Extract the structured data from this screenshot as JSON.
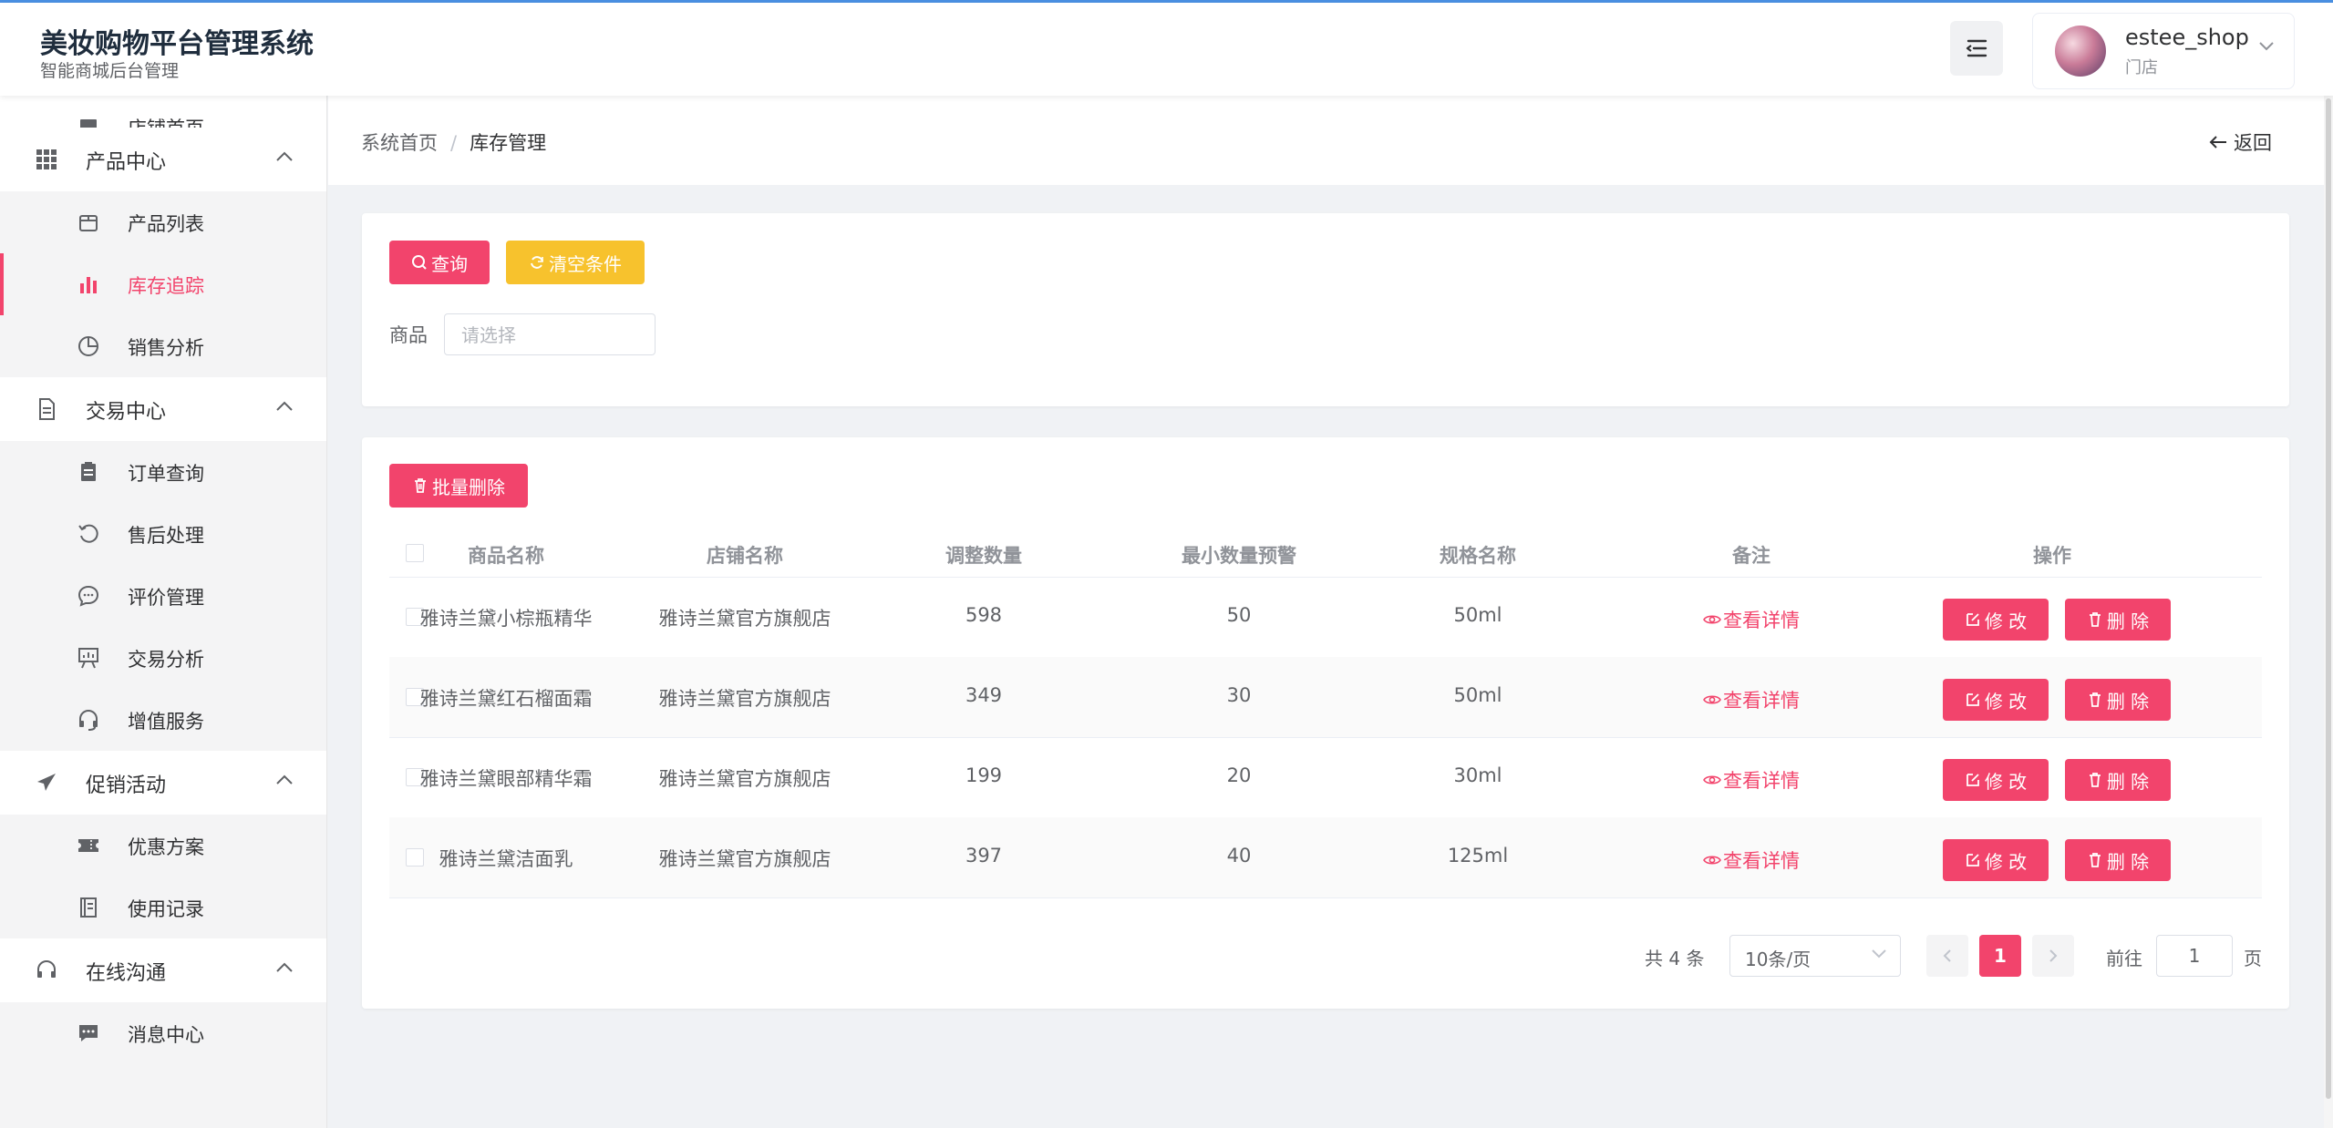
{
  "header": {
    "title": "美妆购物平台管理系统",
    "subtitle": "智能商城后台管理",
    "user": {
      "name": "estee_shop",
      "role": "门店"
    }
  },
  "sidebar": {
    "top_item": "店铺首页",
    "groups": [
      {
        "label": "产品中心",
        "items": [
          "产品列表",
          "库存追踪",
          "销售分析"
        ]
      },
      {
        "label": "交易中心",
        "items": [
          "订单查询",
          "售后处理",
          "评价管理",
          "交易分析",
          "增值服务"
        ]
      },
      {
        "label": "促销活动",
        "items": [
          "优惠方案",
          "使用记录"
        ]
      },
      {
        "label": "在线沟通",
        "items": [
          "消息中心"
        ]
      }
    ],
    "active_item": "库存追踪"
  },
  "breadcrumb": {
    "home": "系统首页",
    "separator": "/",
    "current": "库存管理",
    "back": "返回"
  },
  "search": {
    "query_button": "查询",
    "clear_button": "清空条件",
    "product_label": "商品",
    "product_placeholder": "请选择"
  },
  "table": {
    "batch_delete": "批量删除",
    "columns": [
      "商品名称",
      "店铺名称",
      "调整数量",
      "最小数量预警",
      "规格名称",
      "备注",
      "操作"
    ],
    "rows": [
      {
        "product": "雅诗兰黛小棕瓶精华",
        "shop": "雅诗兰黛官方旗舰店",
        "qty": "598",
        "min_warn": "50",
        "spec": "50ml",
        "note": "查看详情"
      },
      {
        "product": "雅诗兰黛红石榴面霜",
        "shop": "雅诗兰黛官方旗舰店",
        "qty": "349",
        "min_warn": "30",
        "spec": "50ml",
        "note": "查看详情"
      },
      {
        "product": "雅诗兰黛眼部精华霜",
        "shop": "雅诗兰黛官方旗舰店",
        "qty": "199",
        "min_warn": "20",
        "spec": "30ml",
        "note": "查看详情"
      },
      {
        "product": "雅诗兰黛洁面乳",
        "shop": "雅诗兰黛官方旗舰店",
        "qty": "397",
        "min_warn": "40",
        "spec": "125ml",
        "note": "查看详情"
      }
    ],
    "edit_label": "修 改",
    "delete_label": "删 除"
  },
  "pagination": {
    "total": "共 4 条",
    "page_size": "10条/页",
    "current_page": "1",
    "goto_label": "前往",
    "goto_value": "1",
    "page_suffix": "页"
  },
  "colors": {
    "accent": "#f2446c",
    "warning": "#f7c22d",
    "topline": "#4a90e2"
  }
}
